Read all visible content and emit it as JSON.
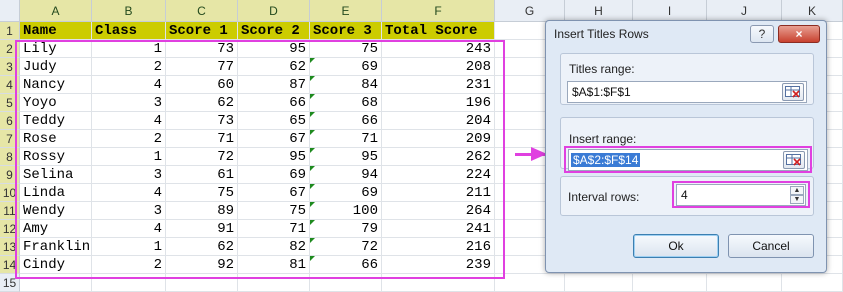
{
  "columns": [
    "A",
    "B",
    "C",
    "D",
    "E",
    "F",
    "G",
    "H",
    "I",
    "J",
    "K"
  ],
  "rows": [
    "1",
    "2",
    "3",
    "4",
    "5",
    "6",
    "7",
    "8",
    "9",
    "10",
    "11",
    "12",
    "13",
    "14",
    "15"
  ],
  "header": [
    "Name",
    "Class",
    "Score 1",
    "Score 2",
    "Score 3",
    "Total Score"
  ],
  "data": [
    [
      "Lily",
      "1",
      "73",
      "95",
      "75",
      "243"
    ],
    [
      "Judy",
      "2",
      "77",
      "62",
      "69",
      "208"
    ],
    [
      "Nancy",
      "4",
      "60",
      "87",
      "84",
      "231"
    ],
    [
      "Yoyo",
      "3",
      "62",
      "66",
      "68",
      "196"
    ],
    [
      "Teddy",
      "4",
      "73",
      "65",
      "66",
      "204"
    ],
    [
      "Rose",
      "2",
      "71",
      "67",
      "71",
      "209"
    ],
    [
      "Rossy",
      "1",
      "72",
      "95",
      "95",
      "262"
    ],
    [
      "Selina",
      "3",
      "61",
      "69",
      "94",
      "224"
    ],
    [
      "Linda",
      "4",
      "75",
      "67",
      "69",
      "211"
    ],
    [
      "Wendy",
      "3",
      "89",
      "75",
      "100",
      "264"
    ],
    [
      "Amy",
      "4",
      "91",
      "71",
      "79",
      "241"
    ],
    [
      "Franklin",
      "1",
      "62",
      "82",
      "72",
      "216"
    ],
    [
      "Cindy",
      "2",
      "92",
      "81",
      "66",
      "239"
    ]
  ],
  "dialog": {
    "title": "Insert Titles Rows",
    "help": "?",
    "close": "×",
    "titles_label": "Titles range:",
    "titles_value": "$A$1:$F$1",
    "insert_label": "Insert range:",
    "insert_value": "$A$2:$F$14",
    "interval_label": "Interval rows:",
    "interval_value": "4",
    "ok": "Ok",
    "cancel": "Cancel"
  },
  "colors": {
    "header_fill": "#cccc00",
    "highlight": "#e040e0",
    "selection": "#3a7bd5"
  }
}
